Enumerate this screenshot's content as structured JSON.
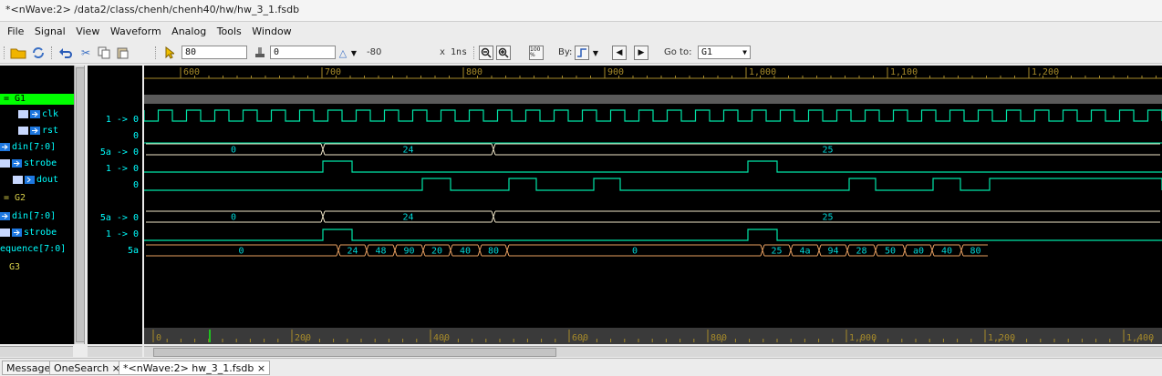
{
  "window": {
    "title": "*<nWave:2> /data2/class/chenh/chenh40/hw/hw_3_1.fsdb"
  },
  "menu": [
    "File",
    "Signal",
    "View",
    "Waveform",
    "Analog",
    "Tools",
    "Window"
  ],
  "toolbar": {
    "cursor_time": "80",
    "marker_time": "0",
    "delta": "-80",
    "time_unit": "x 1ns",
    "by_label": "By:",
    "goto_label": "Go to:",
    "goto_value": "G1",
    "zoom_100": "100 %"
  },
  "ruler_top": {
    "labels": [
      "600",
      "700",
      "800",
      "900",
      "1,000",
      "1,100",
      "1,200"
    ]
  },
  "ruler_bottom": {
    "labels": [
      "0",
      "200",
      "400",
      "600",
      "800",
      "1,000",
      "1,200",
      "1,400"
    ]
  },
  "groups": [
    {
      "label": "= G1"
    },
    {
      "label": "= G2"
    },
    {
      "label": "G3"
    }
  ],
  "signals": [
    {
      "name": "clk",
      "value": "1 -> 0",
      "icon": "var-input-icon"
    },
    {
      "name": "rst",
      "value": "0",
      "icon": "var-input-icon"
    },
    {
      "name": "din[7:0]",
      "value": "5a -> 0",
      "icon": "input-icon"
    },
    {
      "name": "strobe",
      "value": "1 -> 0",
      "icon": "var-input-icon"
    },
    {
      "name": "dout",
      "value": "0",
      "icon": "var-output-icon"
    },
    {
      "name": "din[7:0]",
      "value": "5a -> 0",
      "icon": "input-icon"
    },
    {
      "name": "strobe",
      "value": "1 -> 0",
      "icon": "var-input-icon"
    },
    {
      "name": "equence[7:0]",
      "value": "5a",
      "icon": "none"
    }
  ],
  "waves": {
    "din_g1": [
      "0",
      "24",
      "25"
    ],
    "din_g2": [
      "0",
      "24",
      "25"
    ],
    "sequence": [
      "0",
      "24",
      "48",
      "90",
      "20",
      "40",
      "80",
      "0",
      "25",
      "4a",
      "94",
      "28",
      "50",
      "a0",
      "40",
      "80"
    ]
  },
  "colors": {
    "signal": "#00e6a8",
    "bus": "#f0e6c8",
    "seq": "#e8a060",
    "group_active": "#00ff00",
    "ruler": "#a68a2a"
  },
  "tabs": [
    {
      "label": "Message"
    },
    {
      "label": "OneSearch ×"
    },
    {
      "label": "*<nWave:2> hw_3_1.fsdb ×"
    }
  ]
}
